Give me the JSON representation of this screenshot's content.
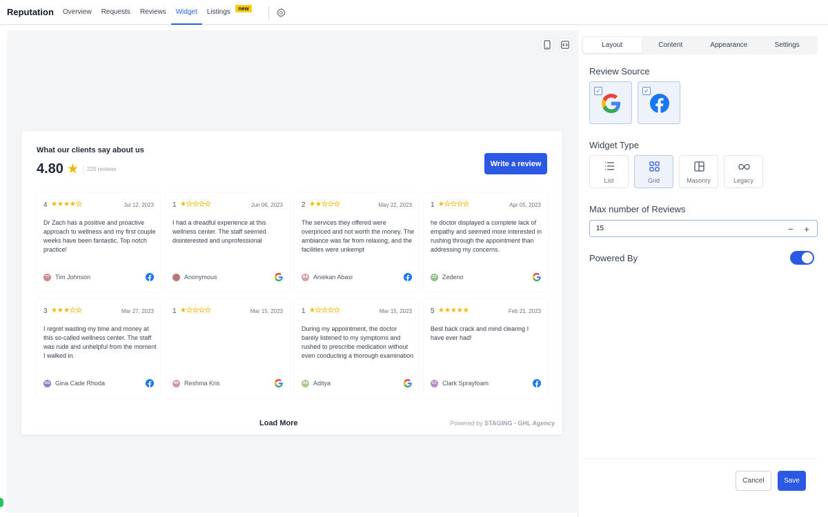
{
  "nav": {
    "brand": "Reputation",
    "tabs": [
      {
        "label": "Overview"
      },
      {
        "label": "Requests"
      },
      {
        "label": "Reviews"
      },
      {
        "label": "Widget",
        "active": true
      },
      {
        "label": "Listings",
        "badge": "new"
      }
    ],
    "settings_icon": "gear-icon"
  },
  "preview": {
    "toolbar_icons": [
      "mobile-icon",
      "code-icon"
    ]
  },
  "widget": {
    "title": "What our clients say about us",
    "rating": "4.80",
    "review_count": "225 reviews",
    "write_review_label": "Write a review",
    "load_more_label": "Load More",
    "powered_prefix": "Powered by",
    "powered_name": "STAGING - GHL Agency",
    "accent_color": "#2b59e3",
    "star_color": "#f5b400",
    "reviews": [
      {
        "score": "4",
        "stars": 4,
        "date": "Jul 12, 2023",
        "text": "Dr Zach has a positive and proactive approach to wellness and my first couple weeks have been fantastic. Top notch practice!",
        "name": "Tim Johnson",
        "initials": "TT",
        "avatar_color": "#c98a8a",
        "source": "facebook"
      },
      {
        "score": "1",
        "stars": 1,
        "date": "Jun 06, 2023",
        "text": "I had a dreadful experience at this wellness center. The staff seemed disinterested and unprofessional",
        "name": "Anonymous",
        "initials": "",
        "avatar_color": "#b87878",
        "source": "google"
      },
      {
        "score": "2",
        "stars": 2,
        "date": "May 22, 2023",
        "text": "The services they offered were overpriced and not worth the money. The ambiance was far from relaxing, and the facilities were unkempt",
        "name": "Aniekan Abasi",
        "initials": "AA",
        "avatar_color": "#d9a0a8",
        "source": "facebook"
      },
      {
        "score": "1",
        "stars": 1,
        "date": "Apr 05, 2023",
        "text": "he doctor displayed a complete lack of empathy and seemed more interested in rushing through the appointment than addressing my concerns.",
        "name": "Zedeno",
        "initials": "ZZ",
        "avatar_color": "#8fbf8f",
        "source": "google"
      },
      {
        "score": "3",
        "stars": 3,
        "date": "Mar 27, 2023",
        "text": "I regret wasting my time and money at this so-called wellness center. The staff was rude and unhelpful from the moment I walked in.",
        "name": "Gina Cade Rhoda",
        "initials": "GG",
        "avatar_color": "#8a83c9",
        "source": "facebook"
      },
      {
        "score": "1",
        "stars": 1,
        "date": "Mar 15, 2023",
        "text": "",
        "name": "Reshma Kris",
        "initials": "RK",
        "avatar_color": "#c99a9a",
        "source": "google"
      },
      {
        "score": "1",
        "stars": 1,
        "date": "Mar 15, 2023",
        "text": "During my appointment, the doctor barely listened to my symptoms and rushed to prescribe medication without even conducting a thorough examination",
        "name": "Aditya",
        "initials": "AA",
        "avatar_color": "#a8c98a",
        "source": "google"
      },
      {
        "score": "5",
        "stars": 5,
        "date": "Feb 21, 2023",
        "text": "Best back crack and mind clearing I have ever had!",
        "name": "Clark Sprayfoam",
        "initials": "CC",
        "avatar_color": "#b08ac9",
        "source": "facebook"
      }
    ]
  },
  "panel": {
    "tabs": [
      {
        "label": "Layout",
        "active": true
      },
      {
        "label": "Content"
      },
      {
        "label": "Appearance"
      },
      {
        "label": "Settings"
      }
    ],
    "review_source_label": "Review Source",
    "sources": [
      {
        "icon": "google-logo-icon",
        "checked": true
      },
      {
        "icon": "facebook-logo-icon",
        "checked": true
      }
    ],
    "widget_type_label": "Widget Type",
    "widget_types": [
      {
        "label": "List",
        "icon": "list-icon"
      },
      {
        "label": "Grid",
        "icon": "grid-icon",
        "active": true
      },
      {
        "label": "Masonry",
        "icon": "masonry-icon"
      },
      {
        "label": "Legacy",
        "icon": "infinity-icon"
      }
    ],
    "max_reviews_label": "Max number of Reviews",
    "max_reviews_value": "15",
    "powered_by_label": "Powered By",
    "powered_by_enabled": true,
    "cancel_label": "Cancel",
    "save_label": "Save"
  }
}
